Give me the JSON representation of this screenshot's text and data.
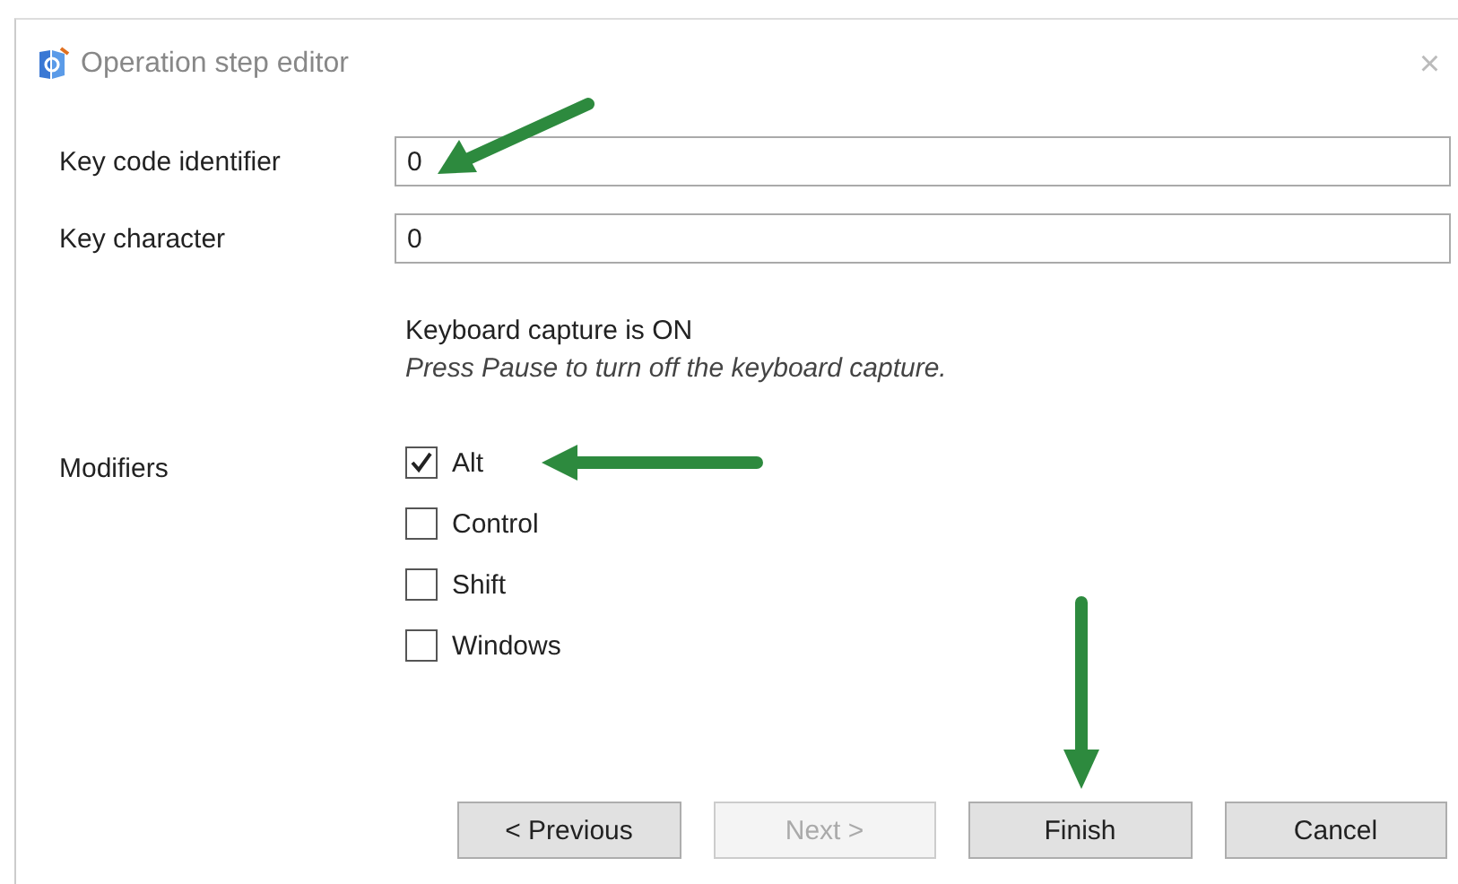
{
  "window": {
    "title": "Operation step editor",
    "close": "×"
  },
  "fields": [
    {
      "label": "Key code identifier",
      "value": "0"
    },
    {
      "label": "Key character",
      "value": "0"
    }
  ],
  "capture": {
    "status": "Keyboard capture is ON",
    "hint": "Press Pause to turn off the keyboard capture."
  },
  "modifiers": {
    "label": "Modifiers",
    "items": [
      {
        "label": "Alt",
        "checked": true
      },
      {
        "label": "Control",
        "checked": false
      },
      {
        "label": "Shift",
        "checked": false
      },
      {
        "label": "Windows",
        "checked": false
      }
    ]
  },
  "buttons": [
    {
      "label": "< Previous",
      "disabled": false
    },
    {
      "label": "Next >",
      "disabled": true
    },
    {
      "label": "Finish",
      "disabled": false
    },
    {
      "label": "Cancel",
      "disabled": false
    }
  ]
}
